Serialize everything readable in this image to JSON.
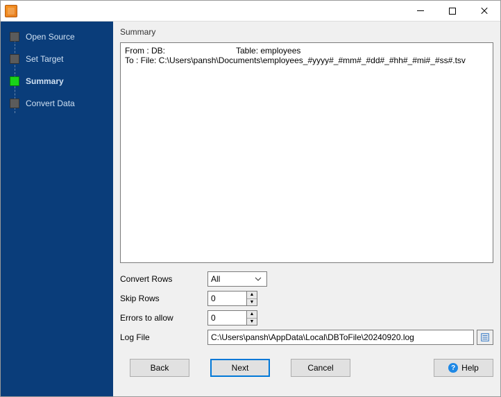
{
  "window": {
    "title": ""
  },
  "sidebar": {
    "items": [
      {
        "label": "Open Source",
        "active": false
      },
      {
        "label": "Set Target",
        "active": false
      },
      {
        "label": "Summary",
        "active": true
      },
      {
        "label": "Convert Data",
        "active": false
      }
    ]
  },
  "main": {
    "section_label": "Summary",
    "summary": {
      "from_prefix": "From : DB:",
      "from_table_label": "Table: employees",
      "to_line": "To : File: C:\\Users\\pansh\\Documents\\employees_#yyyy#_#mm#_#dd#_#hh#_#mi#_#ss#.tsv"
    },
    "form": {
      "convert_rows_label": "Convert Rows",
      "convert_rows_value": "All",
      "skip_rows_label": "Skip Rows",
      "skip_rows_value": "0",
      "errors_label": "Errors to allow",
      "errors_value": "0",
      "logfile_label": "Log File",
      "logfile_value": "C:\\Users\\pansh\\AppData\\Local\\DBToFile\\20240920.log"
    }
  },
  "footer": {
    "back": "Back",
    "next": "Next",
    "cancel": "Cancel",
    "help": "Help"
  }
}
